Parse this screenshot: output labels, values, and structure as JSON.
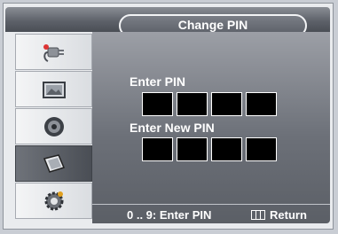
{
  "header": {
    "title": "Change PIN"
  },
  "sidebar": {
    "items": [
      {
        "icon": "plug-icon",
        "active": false
      },
      {
        "icon": "picture-icon",
        "active": false
      },
      {
        "icon": "speaker-icon",
        "active": false
      },
      {
        "icon": "channel-icon",
        "active": true
      },
      {
        "icon": "gear-icon",
        "active": false
      }
    ]
  },
  "main": {
    "enter_pin_label": "Enter PIN",
    "enter_new_pin_label": "Enter New PIN",
    "pin_digits": 4
  },
  "footer": {
    "digits_hint": "0 .. 9: Enter PIN",
    "return_label": "Return"
  },
  "colors": {
    "accent": "#5e626a",
    "digit_box": "#000000"
  }
}
